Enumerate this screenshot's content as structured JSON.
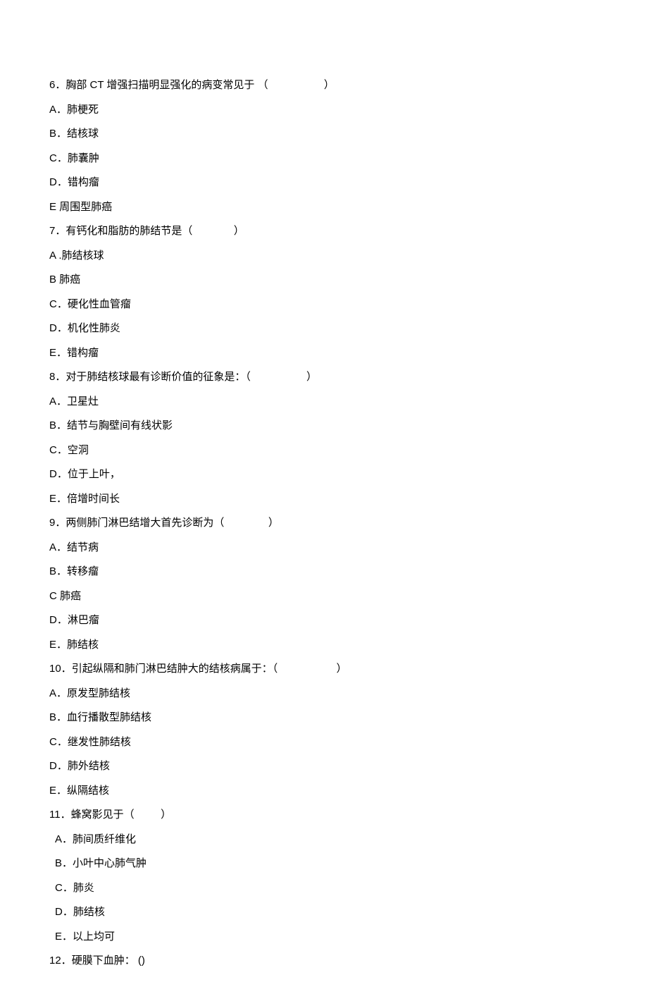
{
  "questions": [
    {
      "num": "6．",
      "text": "胸部 CT 增强扫描明显强化的病变常见于 （                   ）",
      "options": [
        {
          "label": "A．",
          "text": "肺梗死"
        },
        {
          "label": "B．",
          "text": "结核球"
        },
        {
          "label": "C．",
          "text": "肺囊肿"
        },
        {
          "label": "D．",
          "text": "错构瘤"
        },
        {
          "label": "E",
          "text": " 周围型肺癌"
        }
      ]
    },
    {
      "num": "7．",
      "text": "有钙化和脂肪的肺结节是（              ）",
      "options": [
        {
          "label": "A",
          "text": " .肺结核球"
        },
        {
          "label": "B",
          "text": " 肺癌"
        },
        {
          "label": "C．",
          "text": "硬化性血管瘤"
        },
        {
          "label": "D．",
          "text": "机化性肺炎"
        },
        {
          "label": "E．",
          "text": "错构瘤"
        }
      ]
    },
    {
      "num": "8．",
      "text": "对于肺结核球最有诊断价值的征象是：（                   ）",
      "options": [
        {
          "label": "A．",
          "text": "卫星灶"
        },
        {
          "label": "B．",
          "text": "结节与胸壁间有线状影"
        },
        {
          "label": "C．",
          "text": "空洞"
        },
        {
          "label": "D．",
          "text": "位于上叶，"
        },
        {
          "label": "E．",
          "text": "倍增时间长"
        }
      ]
    },
    {
      "num": "9．",
      "text": "两侧肺门淋巴结增大首先诊断为（               ）",
      "options": [
        {
          "label": "A．",
          "text": "结节病"
        },
        {
          "label": "B．",
          "text": "转移瘤"
        },
        {
          "label": "C",
          "text": " 肺癌"
        },
        {
          "label": "D．",
          "text": "淋巴瘤"
        },
        {
          "label": "E．",
          "text": "肺结核"
        }
      ]
    },
    {
      "num": "10．",
      "text": "引起纵隔和肺门淋巴结肿大的结核病属于：（                    ）",
      "options": [
        {
          "label": "A．",
          "text": "原发型肺结核"
        },
        {
          "label": "B．",
          "text": "血行播散型肺结核"
        },
        {
          "label": "C．",
          "text": "继发性肺结核"
        },
        {
          "label": "D．",
          "text": "肺外结核"
        },
        {
          "label": "E．",
          "text": "纵隔结核"
        }
      ]
    },
    {
      "num": "11．",
      "text": "蜂窝影见于（         ）",
      "indent": true,
      "options": [
        {
          "label": "A．",
          "text": "肺间质纤维化"
        },
        {
          "label": "B．",
          "text": "小叶中心肺气肿"
        },
        {
          "label": "C．",
          "text": "肺炎"
        },
        {
          "label": "D．",
          "text": "肺结核"
        },
        {
          "label": "E．",
          "text": "以上均可"
        }
      ]
    },
    {
      "num": "12．",
      "text": "硬膜下血肿： ()",
      "options": []
    }
  ]
}
